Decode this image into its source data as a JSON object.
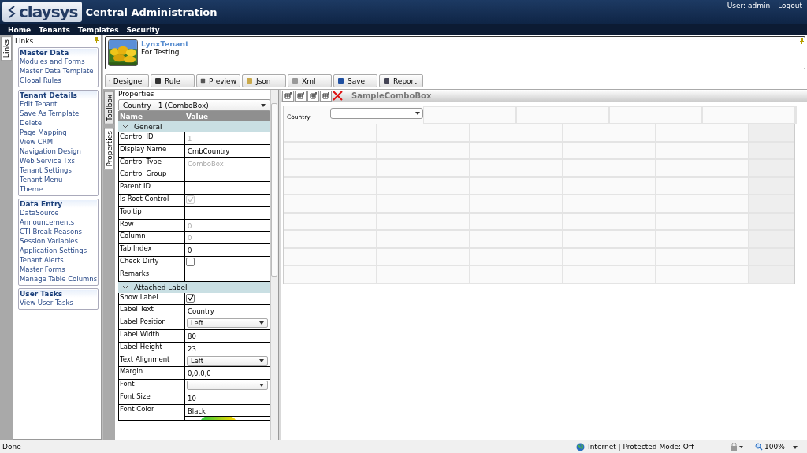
{
  "header": {
    "logo": "claysys",
    "title": "Central Administration",
    "user": "User: admin",
    "logout": "Logout"
  },
  "menu": [
    "Home",
    "Tenants",
    "Templates",
    "Security"
  ],
  "links_tab": "Links",
  "links_panel": {
    "title": "Links",
    "groups": [
      {
        "title": "Master Data",
        "items": [
          "Modules and Forms",
          "Master Data Template",
          "Global Rules"
        ]
      },
      {
        "title": "Tenant Details",
        "items": [
          "Edit Tenant",
          "Save As Template",
          "Delete",
          "Page Mapping",
          "View CRM",
          "Navigation Design",
          "Web Service Txs",
          "Tenant Settings",
          "Tenant Menu",
          "Theme"
        ]
      },
      {
        "title": "Data Entry",
        "items": [
          "DataSource",
          "Announcements",
          "CTI-Break Reasons",
          "Session Variables",
          "Application Settings",
          "Tenant Alerts",
          "Master Forms",
          "Manage Table Columns"
        ]
      },
      {
        "title": "User Tasks",
        "items": [
          "View User Tasks"
        ]
      }
    ]
  },
  "tenant": {
    "name": "LynxTenant",
    "description": "For Testing"
  },
  "toolbar": [
    "Designer",
    "Rule",
    "Preview",
    "Json",
    "Xml",
    "Save",
    "Report"
  ],
  "side_tabs": [
    {
      "label": "Toolbox",
      "selected": false
    },
    {
      "label": "Properties",
      "selected": true
    }
  ],
  "properties": {
    "title": "Properties",
    "selector": "Country - 1 (ComboBox)",
    "columns": [
      "Name",
      "Value"
    ],
    "sections": [
      {
        "title": "General",
        "expanded": true,
        "rows": [
          {
            "name": "Control ID",
            "kind": "text",
            "value": "1",
            "disabled": true
          },
          {
            "name": "Display Name",
            "kind": "text",
            "value": "CmbCountry",
            "disabled": false
          },
          {
            "name": "Control Type",
            "kind": "text",
            "value": "ComboBox",
            "disabled": true
          },
          {
            "name": "Control Group",
            "kind": "text",
            "disabled": false
          },
          {
            "name": "Parent ID",
            "kind": "text",
            "disabled": false
          },
          {
            "name": "Is Root Control",
            "kind": "checkbox",
            "checked": true,
            "disabled": true
          },
          {
            "name": "Tooltip",
            "kind": "text",
            "disabled": false
          },
          {
            "name": "Row",
            "kind": "text",
            "value": "0",
            "disabled": true
          },
          {
            "name": "Column",
            "kind": "text",
            "value": "0",
            "disabled": true
          },
          {
            "name": "Tab Index",
            "kind": "text",
            "value": "0",
            "disabled": false
          },
          {
            "name": "Check Dirty",
            "kind": "checkbox",
            "checked": false,
            "disabled": false
          },
          {
            "name": "Remarks",
            "kind": "text",
            "disabled": false
          }
        ]
      },
      {
        "title": "Attached Label",
        "expanded": true,
        "rows": [
          {
            "name": "Show Label",
            "kind": "checkbox",
            "checked": true,
            "disabled": false
          },
          {
            "name": "Label Text",
            "kind": "text",
            "value": "Country",
            "disabled": false
          },
          {
            "name": "Label Position",
            "kind": "select",
            "value": "Left",
            "disabled": false
          },
          {
            "name": "Label Width",
            "kind": "text",
            "value": "80",
            "disabled": false
          },
          {
            "name": "Label Height",
            "kind": "text",
            "value": "23",
            "disabled": false
          },
          {
            "name": "Text Alignment",
            "kind": "select",
            "value": "Left",
            "disabled": false
          },
          {
            "name": "Margin",
            "kind": "text",
            "value": "0,0,0,0",
            "disabled": false
          },
          {
            "name": "Font",
            "kind": "select",
            "disabled": false
          },
          {
            "name": "Font Size",
            "kind": "text",
            "value": "10",
            "disabled": false
          },
          {
            "name": "Font Color",
            "kind": "color",
            "value": "Black",
            "disabled": false
          }
        ]
      }
    ]
  },
  "designer": {
    "title": "SampleComboBox",
    "label": "Country"
  },
  "status_bar": {
    "text": "Done",
    "zone": "Internet | Protected Mode: Off",
    "zoom": "100%"
  }
}
